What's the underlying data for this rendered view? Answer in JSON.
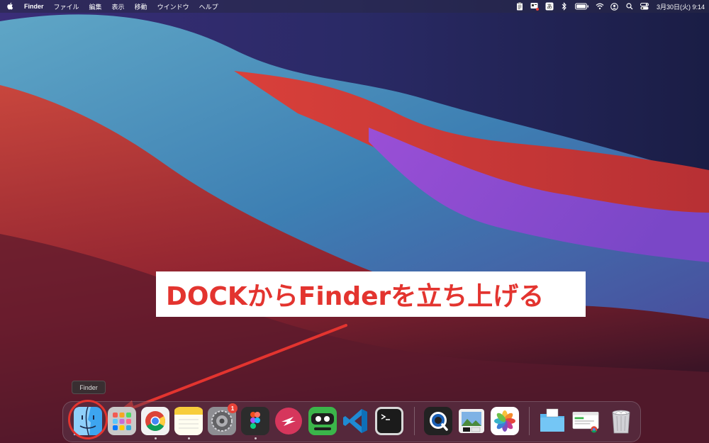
{
  "menubar": {
    "app_name": "Finder",
    "menus": [
      "ファイル",
      "編集",
      "表示",
      "移動",
      "ウインドウ",
      "ヘルプ"
    ],
    "clock": "3月30日(火)  9:14",
    "input_method_label": "あ"
  },
  "callout": {
    "text": "DOCKからFinderを立ち上げる"
  },
  "dock": {
    "tooltip": "Finder",
    "settings_badge": "1"
  },
  "colors": {
    "callout_text": "#e3342f",
    "annotation_red": "#e3342f"
  }
}
